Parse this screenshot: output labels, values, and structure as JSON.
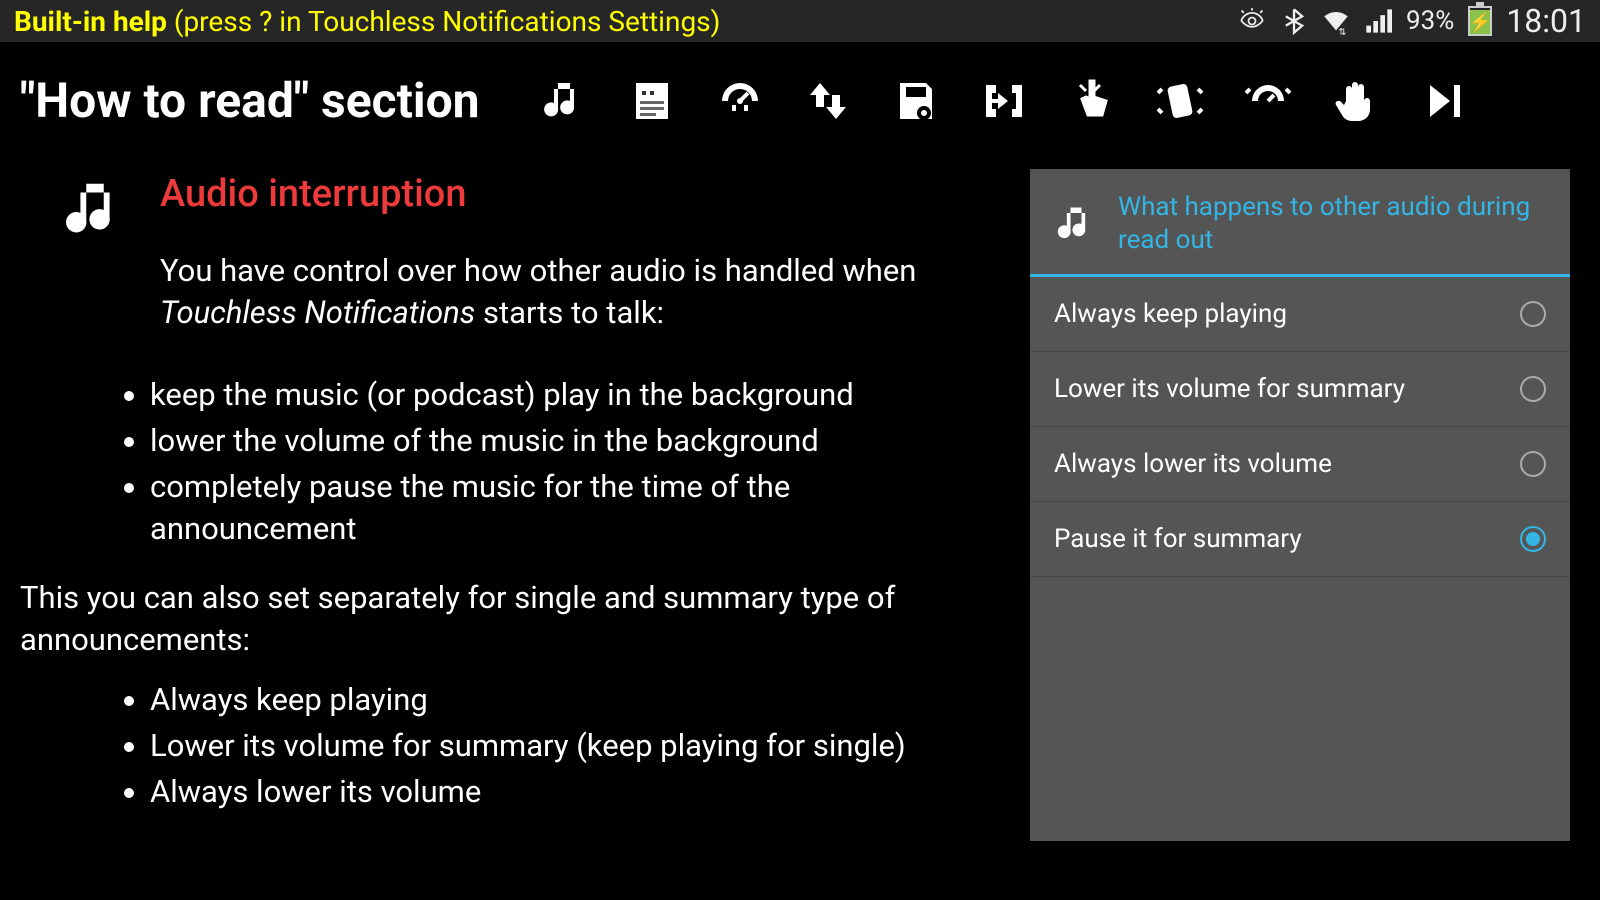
{
  "status": {
    "help_label": "Built-in help",
    "help_hint": "(press ? in Touchless Notifications Settings)",
    "battery_pct": "93%",
    "time": "18:01"
  },
  "header": {
    "title": "\"How to read\" section",
    "icons": [
      "music",
      "quote-doc",
      "gauge-quote",
      "up-down",
      "disk-eye",
      "back-bracket",
      "touch",
      "shake",
      "shake-gauge",
      "hand",
      "next"
    ]
  },
  "article": {
    "section_title": "Audio interruption",
    "intro_before": "You have control over how other audio is handled when ",
    "intro_italic": "Touchless Notifications",
    "intro_after": " starts to talk:",
    "bullets1": [
      "keep the music (or podcast) play in the background",
      "lower the volume of the music in the background",
      "completely pause the music for the time of the announcement"
    ],
    "followup": "This you can also set separately for single and summary type of announcements:",
    "bullets2": [
      "Always keep playing",
      "Lower its volume for summary (keep playing for single)",
      "Always lower its volume"
    ]
  },
  "dialog": {
    "title": "What happens to other audio during read out",
    "options": [
      {
        "label": "Always keep playing",
        "selected": false
      },
      {
        "label": "Lower its volume for summary",
        "selected": false
      },
      {
        "label": "Always lower its volume",
        "selected": false
      },
      {
        "label": "Pause it for summary",
        "selected": true
      }
    ]
  }
}
